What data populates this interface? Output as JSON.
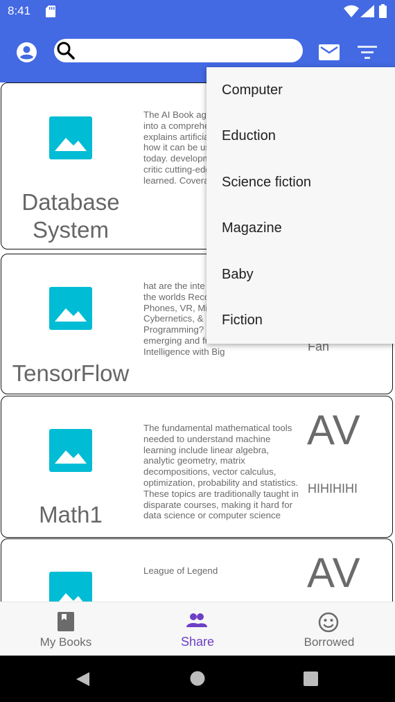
{
  "status_bar": {
    "time": "8:41"
  },
  "search": {
    "value": "",
    "placeholder": ""
  },
  "books": [
    {
      "title": "Database\nSystem",
      "description": "The AI Book aggregates its expertise into a comprehensive volume and explains artificial intelligence really is, how it can be used and services today. developments a detail, and critic cutting-edge pr first-hand inform learned. Covera",
      "avatar": "",
      "owner": ""
    },
    {
      "title": "TensorFlow",
      "description": "hat are the inte between AI, U.S and the worlds Recognition, Bio Smart Phones, VR, Mixed Reality, Cybernetics, & Bio-Digital Social Programming? We will cover present, emerging and future threats of Artificial Intelligence with Big",
      "avatar": "",
      "owner": "Fan"
    },
    {
      "title": "Math1",
      "description": "The fundamental mathematical tools needed to understand machine learning include linear algebra, analytic geometry, matrix decompositions, vector calculus, optimization, probability and statistics. These topics are traditionally taught in disparate courses, making it hard for data science or computer science",
      "avatar": "AV",
      "owner": "HIHIHIHI"
    },
    {
      "title": "",
      "description": "League of Legend",
      "avatar": "AV",
      "owner": ""
    }
  ],
  "dropdown": {
    "items": [
      "Computer",
      "Eduction",
      "Science fiction",
      "Magazine",
      "Baby",
      "Fiction"
    ]
  },
  "bottom_nav": {
    "tabs": [
      {
        "label": "My Books",
        "icon": "book-icon",
        "active": false
      },
      {
        "label": "Share",
        "icon": "people-icon",
        "active": true
      },
      {
        "label": "Borrowed",
        "icon": "smiley-icon",
        "active": false
      }
    ]
  },
  "colors": {
    "app_bar": "#4369e3",
    "image_placeholder": "#00bcd4",
    "active_tab": "#6c3fc6"
  }
}
